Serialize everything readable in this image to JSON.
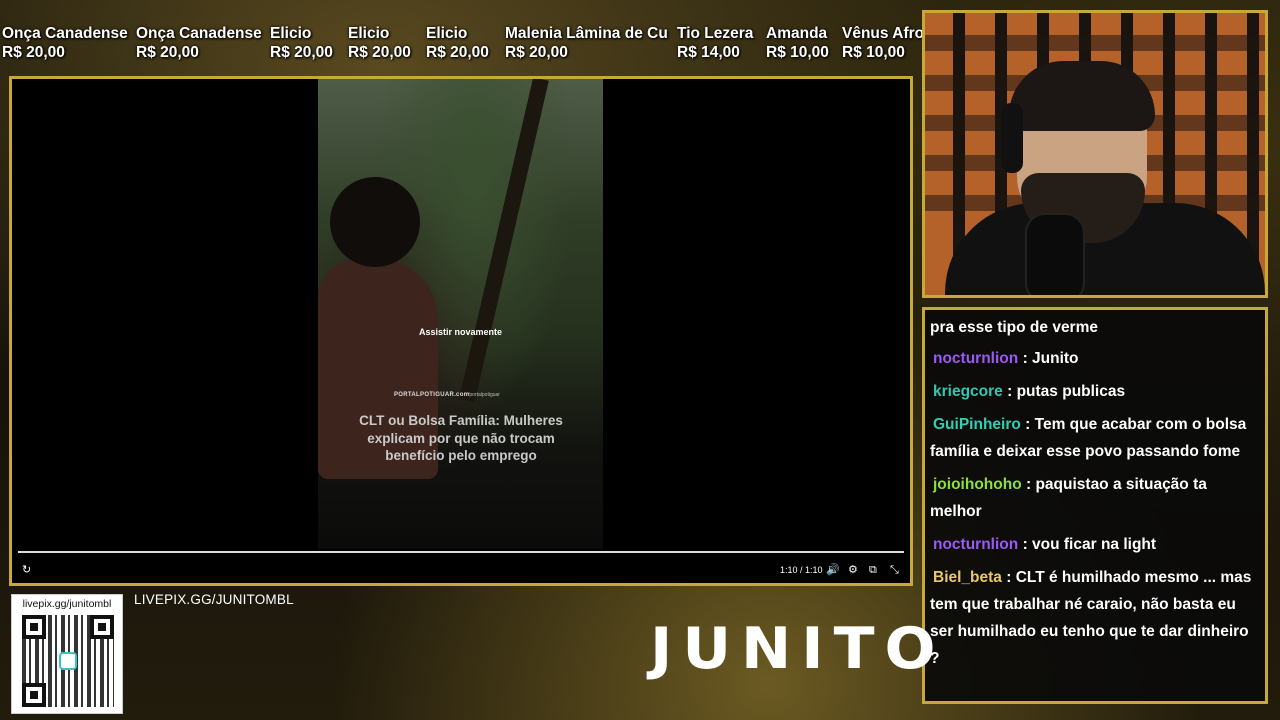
{
  "ticker": {
    "donations": [
      {
        "name": "Onça Canadense",
        "amount": "R$ 20,00"
      },
      {
        "name": "Onça Canadense",
        "amount": "R$ 20,00"
      },
      {
        "name": "Elicio",
        "amount": "R$ 20,00"
      },
      {
        "name": "Elicio",
        "amount": "R$ 20,00"
      },
      {
        "name": "Elicio",
        "amount": "R$ 20,00"
      },
      {
        "name": "Malenia Lâmina de Cu",
        "amount": "R$ 20,00"
      },
      {
        "name": "Tio Lezera",
        "amount": "R$ 14,00"
      },
      {
        "name": "Amanda",
        "amount": "R$ 10,00"
      },
      {
        "name": "Vênus Afro",
        "amount": "R$ 10,00"
      }
    ]
  },
  "player": {
    "replay_label": "Assistir novamente",
    "portal_logo": "PORTALPOTIGUAR.com",
    "portal_handle": "/portalpotiguar",
    "headline": "CLT ou Bolsa Família: Mulheres explicam por que não trocam benefício pelo emprego",
    "time": "1:10 / 1:10",
    "progress": 1.0,
    "icons": {
      "replay": "↻",
      "volume": "🔊",
      "settings": "⚙",
      "miniplayer": "⧉",
      "exit_fullscreen": "⤡"
    }
  },
  "chat": {
    "messages": [
      {
        "user": "",
        "user_color": "#ffffff",
        "text": "pra esse tipo de verme"
      },
      {
        "user": "nocturnlion",
        "user_color": "#9b59f5",
        "text": "Junito"
      },
      {
        "user": "kriegcore",
        "user_color": "#32c8b0",
        "text": "putas publicas"
      },
      {
        "user": "GuiPinheiro",
        "user_color": "#2fd0b4",
        "text": "Tem que acabar com o bolsa família e deixar esse povo passando fome"
      },
      {
        "user": "joioihohoho",
        "user_color": "#8be03c",
        "text": "paquistao a situação ta melhor"
      },
      {
        "user": "nocturnlion",
        "user_color": "#9b59f5",
        "text": "vou ficar na light"
      },
      {
        "user": "Biel_beta",
        "user_color": "#e8c86a",
        "text": "CLT é humilhado mesmo ... mas tem que trabalhar né caraio, não basta eu ser humilhado eu tenho que te dar dinheiro ?"
      }
    ]
  },
  "footer": {
    "qr_label": "livepix.gg/junitombl",
    "livepix_text": "LIVEPIX.GG/JUNITOMBL",
    "brand": "JUNITO"
  }
}
